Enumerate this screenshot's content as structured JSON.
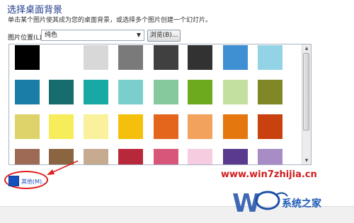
{
  "header": {
    "title": "选择桌面背景",
    "description": "单击某个图片使其成为您的桌面背景，或选择多个图片创建一个幻灯片。"
  },
  "picture_location": {
    "label": "图片位置(L):",
    "selected": "纯色",
    "browse_label": "浏览(B)..."
  },
  "swatches": [
    "#000000",
    "#ffffff",
    "#d8d8d8",
    "#7a7a7a",
    "#404040",
    "#323232",
    "#3f8fd3",
    "#92d3e6",
    "#1a7da8",
    "#176c6e",
    "#18a9a4",
    "#7acfcc",
    "#86c99c",
    "#6eaa1e",
    "#c4e0a0",
    "#7f8726",
    "#ddd36a",
    "#f7ec5a",
    "#f9f19c",
    "#f5c00b",
    "#e4661d",
    "#f3a25e",
    "#e5770f",
    "#c8410e",
    "#9e6a56",
    "#8b6541",
    "#c6ab90",
    "#b7293a",
    "#d9567b",
    "#f5cce0",
    "#593a8e",
    "#a88cc5"
  ],
  "other": {
    "label": "其他(M)...",
    "color": "#1552c1"
  },
  "watermark": {
    "url": "www.win7zhijia.cn",
    "brand": "系统之家"
  }
}
